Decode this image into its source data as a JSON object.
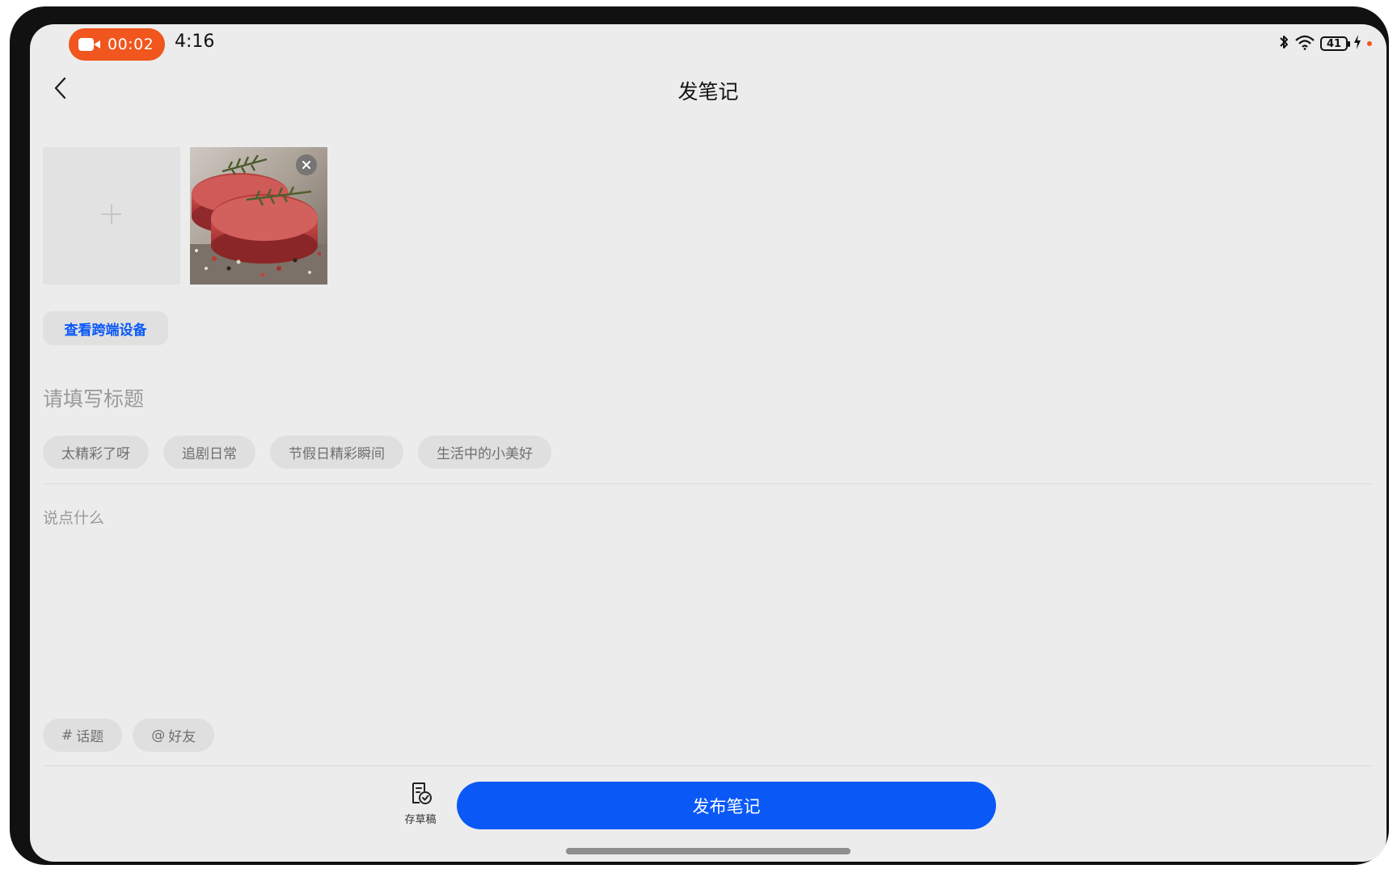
{
  "status_bar": {
    "recording_time": "00:02",
    "clock": "4:16",
    "battery_level": "41"
  },
  "header": {
    "title": "发笔记",
    "back_icon": "chevron-left-icon"
  },
  "media": {
    "add_icon": "plus-icon",
    "photo_description_icon": "raw-steak-photo",
    "remove_icon": "close-icon"
  },
  "device_button": {
    "label": "查看跨端设备"
  },
  "title_field": {
    "placeholder": "请填写标题",
    "value": ""
  },
  "suggested_chips": [
    {
      "label": "太精彩了呀"
    },
    {
      "label": "追剧日常"
    },
    {
      "label": "节假日精彩瞬间"
    },
    {
      "label": "生活中的小美好"
    }
  ],
  "body_field": {
    "placeholder": "说点什么",
    "value": ""
  },
  "tag_chips": {
    "topic": {
      "symbol": "#",
      "label": "话题"
    },
    "friend": {
      "symbol": "@",
      "label": "好友"
    }
  },
  "footer": {
    "draft_label": "存草稿",
    "publish_label": "发布笔记"
  },
  "colors": {
    "accent": "#0a59f7",
    "recording": "#f0561d",
    "background": "#ececec"
  }
}
